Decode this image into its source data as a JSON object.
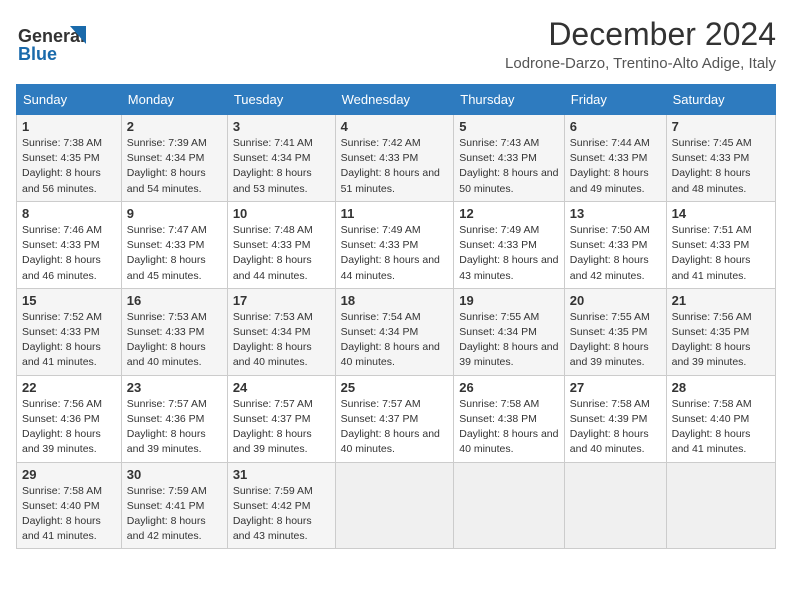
{
  "header": {
    "logo_line1": "General",
    "logo_line2": "Blue",
    "title": "December 2024",
    "subtitle": "Lodrone-Darzo, Trentino-Alto Adige, Italy"
  },
  "columns": [
    "Sunday",
    "Monday",
    "Tuesday",
    "Wednesday",
    "Thursday",
    "Friday",
    "Saturday"
  ],
  "weeks": [
    [
      {
        "day": "1",
        "sunrise": "7:38 AM",
        "sunset": "4:35 PM",
        "daylight": "8 hours and 56 minutes."
      },
      {
        "day": "2",
        "sunrise": "7:39 AM",
        "sunset": "4:34 PM",
        "daylight": "8 hours and 54 minutes."
      },
      {
        "day": "3",
        "sunrise": "7:41 AM",
        "sunset": "4:34 PM",
        "daylight": "8 hours and 53 minutes."
      },
      {
        "day": "4",
        "sunrise": "7:42 AM",
        "sunset": "4:33 PM",
        "daylight": "8 hours and 51 minutes."
      },
      {
        "day": "5",
        "sunrise": "7:43 AM",
        "sunset": "4:33 PM",
        "daylight": "8 hours and 50 minutes."
      },
      {
        "day": "6",
        "sunrise": "7:44 AM",
        "sunset": "4:33 PM",
        "daylight": "8 hours and 49 minutes."
      },
      {
        "day": "7",
        "sunrise": "7:45 AM",
        "sunset": "4:33 PM",
        "daylight": "8 hours and 48 minutes."
      }
    ],
    [
      {
        "day": "8",
        "sunrise": "7:46 AM",
        "sunset": "4:33 PM",
        "daylight": "8 hours and 46 minutes."
      },
      {
        "day": "9",
        "sunrise": "7:47 AM",
        "sunset": "4:33 PM",
        "daylight": "8 hours and 45 minutes."
      },
      {
        "day": "10",
        "sunrise": "7:48 AM",
        "sunset": "4:33 PM",
        "daylight": "8 hours and 44 minutes."
      },
      {
        "day": "11",
        "sunrise": "7:49 AM",
        "sunset": "4:33 PM",
        "daylight": "8 hours and 44 minutes."
      },
      {
        "day": "12",
        "sunrise": "7:49 AM",
        "sunset": "4:33 PM",
        "daylight": "8 hours and 43 minutes."
      },
      {
        "day": "13",
        "sunrise": "7:50 AM",
        "sunset": "4:33 PM",
        "daylight": "8 hours and 42 minutes."
      },
      {
        "day": "14",
        "sunrise": "7:51 AM",
        "sunset": "4:33 PM",
        "daylight": "8 hours and 41 minutes."
      }
    ],
    [
      {
        "day": "15",
        "sunrise": "7:52 AM",
        "sunset": "4:33 PM",
        "daylight": "8 hours and 41 minutes."
      },
      {
        "day": "16",
        "sunrise": "7:53 AM",
        "sunset": "4:33 PM",
        "daylight": "8 hours and 40 minutes."
      },
      {
        "day": "17",
        "sunrise": "7:53 AM",
        "sunset": "4:34 PM",
        "daylight": "8 hours and 40 minutes."
      },
      {
        "day": "18",
        "sunrise": "7:54 AM",
        "sunset": "4:34 PM",
        "daylight": "8 hours and 40 minutes."
      },
      {
        "day": "19",
        "sunrise": "7:55 AM",
        "sunset": "4:34 PM",
        "daylight": "8 hours and 39 minutes."
      },
      {
        "day": "20",
        "sunrise": "7:55 AM",
        "sunset": "4:35 PM",
        "daylight": "8 hours and 39 minutes."
      },
      {
        "day": "21",
        "sunrise": "7:56 AM",
        "sunset": "4:35 PM",
        "daylight": "8 hours and 39 minutes."
      }
    ],
    [
      {
        "day": "22",
        "sunrise": "7:56 AM",
        "sunset": "4:36 PM",
        "daylight": "8 hours and 39 minutes."
      },
      {
        "day": "23",
        "sunrise": "7:57 AM",
        "sunset": "4:36 PM",
        "daylight": "8 hours and 39 minutes."
      },
      {
        "day": "24",
        "sunrise": "7:57 AM",
        "sunset": "4:37 PM",
        "daylight": "8 hours and 39 minutes."
      },
      {
        "day": "25",
        "sunrise": "7:57 AM",
        "sunset": "4:37 PM",
        "daylight": "8 hours and 40 minutes."
      },
      {
        "day": "26",
        "sunrise": "7:58 AM",
        "sunset": "4:38 PM",
        "daylight": "8 hours and 40 minutes."
      },
      {
        "day": "27",
        "sunrise": "7:58 AM",
        "sunset": "4:39 PM",
        "daylight": "8 hours and 40 minutes."
      },
      {
        "day": "28",
        "sunrise": "7:58 AM",
        "sunset": "4:40 PM",
        "daylight": "8 hours and 41 minutes."
      }
    ],
    [
      {
        "day": "29",
        "sunrise": "7:58 AM",
        "sunset": "4:40 PM",
        "daylight": "8 hours and 41 minutes."
      },
      {
        "day": "30",
        "sunrise": "7:59 AM",
        "sunset": "4:41 PM",
        "daylight": "8 hours and 42 minutes."
      },
      {
        "day": "31",
        "sunrise": "7:59 AM",
        "sunset": "4:42 PM",
        "daylight": "8 hours and 43 minutes."
      },
      null,
      null,
      null,
      null
    ]
  ],
  "cell_labels": {
    "sunrise": "Sunrise:",
    "sunset": "Sunset:",
    "daylight": "Daylight:"
  }
}
